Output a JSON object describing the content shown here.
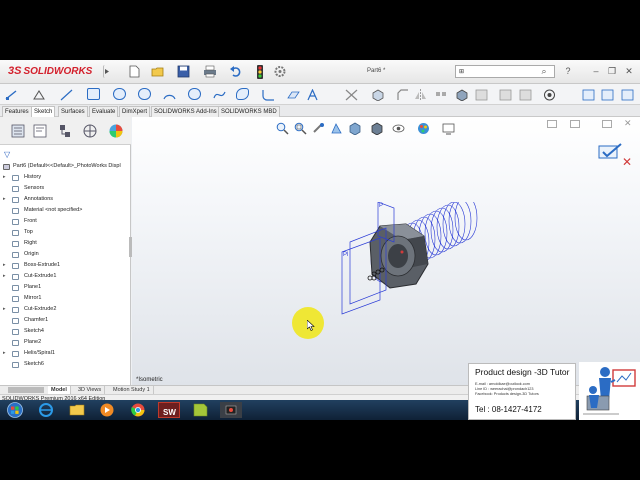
{
  "app": {
    "logo_text": "SOLIDWORKS",
    "logo_ds": "3S",
    "document_title": "Part6 *",
    "search_label": "",
    "search_placeholder": "",
    "help_icon": "?",
    "window_controls": [
      "minimize",
      "restore",
      "close"
    ]
  },
  "command_tabs": [
    {
      "label": "Features",
      "active": false
    },
    {
      "label": "Sketch",
      "active": true
    },
    {
      "label": "Surfaces",
      "active": false
    },
    {
      "label": "Evaluate",
      "active": false
    },
    {
      "label": "DimXpert",
      "active": false
    },
    {
      "label": "SOLIDWORKS Add-Ins",
      "active": false
    },
    {
      "label": "SOLIDWORKS MBD",
      "active": false
    }
  ],
  "feature_tree": {
    "root": "Part6 (Default<<Default>_PhotoWorks Displ",
    "items": [
      {
        "label": "History",
        "expandable": true
      },
      {
        "label": "Sensors",
        "expandable": false
      },
      {
        "label": "Annotations",
        "expandable": true
      },
      {
        "label": "Material <not specified>",
        "expandable": false
      },
      {
        "label": "Front",
        "expandable": false
      },
      {
        "label": "Top",
        "expandable": false
      },
      {
        "label": "Right",
        "expandable": false
      },
      {
        "label": "Origin",
        "expandable": false
      },
      {
        "label": "Boss-Extrude1",
        "expandable": true
      },
      {
        "label": "Cut-Extrude1",
        "expandable": true
      },
      {
        "label": "Plane1",
        "expandable": false
      },
      {
        "label": "Mirror1",
        "expandable": false
      },
      {
        "label": "Cut-Extrude2",
        "expandable": true
      },
      {
        "label": "Chamfer1",
        "expandable": false
      },
      {
        "label": "Sketch4",
        "expandable": false
      },
      {
        "label": "Plane2",
        "expandable": false
      },
      {
        "label": "Helix/Spiral1",
        "expandable": true
      },
      {
        "label": "Sketch6",
        "expandable": false
      }
    ]
  },
  "viewport": {
    "view_label": "*Isometric",
    "background_top": "#ffffff",
    "background_bottom": "#dfe3e9",
    "plane_color": "#2a3bd6",
    "nut_color": "#5a5f66"
  },
  "bottom_tabs": [
    {
      "label": "Model",
      "active": true
    },
    {
      "label": "3D Views",
      "active": false
    },
    {
      "label": "Motion Study 1",
      "active": false
    }
  ],
  "status_bar": {
    "text": "SOLIDWORKS Premium 2016 x64 Edition"
  },
  "ad": {
    "title": "Product design -3D Tutor",
    "email": "E-mail :    arnoldkae@outlook.com",
    "line_id": "Line ID :    weerachai@prondach123",
    "facebook": "Facebook:  Products design-3D Tutors",
    "tel": "Tel  : 08-1427-4172"
  },
  "taskbar_apps": [
    "start-orb",
    "internet-explorer",
    "file-explorer",
    "media-player",
    "chrome",
    "solidworks",
    "notepad",
    "screen-recorder"
  ]
}
